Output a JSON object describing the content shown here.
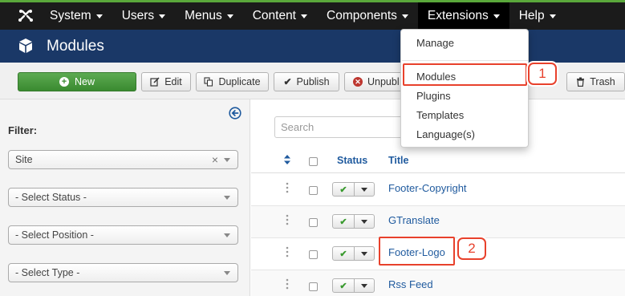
{
  "topnav": {
    "items": [
      {
        "label": "System"
      },
      {
        "label": "Users"
      },
      {
        "label": "Menus"
      },
      {
        "label": "Content"
      },
      {
        "label": "Components"
      },
      {
        "label": "Extensions"
      },
      {
        "label": "Help"
      }
    ]
  },
  "header": {
    "title": "Modules"
  },
  "toolbar": {
    "new_label": "New",
    "edit_label": "Edit",
    "duplicate_label": "Duplicate",
    "publish_label": "Publish",
    "unpublish_label": "Unpubl",
    "trash_label": "Trash"
  },
  "sidebar": {
    "filter_label": "Filter:",
    "site_value": "Site",
    "clear_glyph": "×",
    "status_placeholder": "- Select Status -",
    "position_placeholder": "- Select Position -",
    "type_placeholder": "- Select Type -"
  },
  "main": {
    "search_placeholder": "Search",
    "columns": {
      "status": "Status",
      "title": "Title"
    },
    "rows": [
      {
        "title": "Footer-Copyright",
        "check": "✔"
      },
      {
        "title": "GTranslate",
        "check": "✔"
      },
      {
        "title": "Footer-Logo",
        "check": "✔"
      },
      {
        "title": "Rss Feed",
        "check": "✔"
      }
    ]
  },
  "extensions_menu": {
    "items": [
      "Manage",
      "Modules",
      "Plugins",
      "Templates",
      "Language(s)"
    ]
  },
  "callouts": {
    "one": "1",
    "two": "2"
  },
  "colors": {
    "nav_bg": "#1b1b1b",
    "header_bg": "#1a3867",
    "new_button": "#46993b",
    "link": "#1f5a9e",
    "callout": "#e8412c"
  }
}
